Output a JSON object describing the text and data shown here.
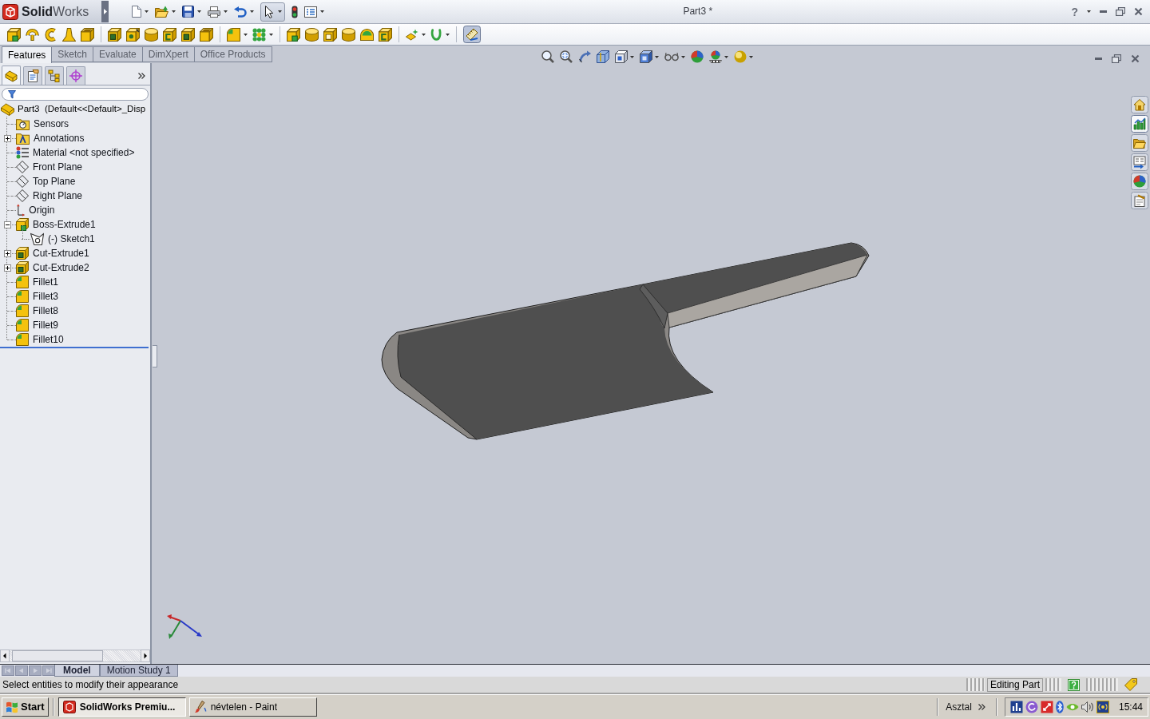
{
  "window": {
    "app_name": "**Solid**Works",
    "title": "Part3 *",
    "help": "?"
  },
  "command_tabs": [
    {
      "label": "Features",
      "selected": true
    },
    {
      "label": "Sketch",
      "selected": false
    },
    {
      "label": "Evaluate",
      "selected": false
    },
    {
      "label": "DimXpert",
      "selected": false
    },
    {
      "label": "Office Products",
      "selected": false
    }
  ],
  "panel_tabs": [
    {
      "kind": "feature-manager",
      "selected": true
    },
    {
      "kind": "property-manager",
      "selected": false
    },
    {
      "kind": "configuration-manager",
      "selected": false
    },
    {
      "kind": "dimxpert-manager",
      "selected": false
    }
  ],
  "feature_tree": {
    "root": "Part3  (Default<<Default>_Disp",
    "items": [
      {
        "kind": "sensors",
        "label": "Sensors"
      },
      {
        "kind": "annotations",
        "label": "Annotations",
        "expanded": false
      },
      {
        "kind": "material",
        "label": "Material <not specified>"
      },
      {
        "kind": "plane",
        "label": "Front Plane"
      },
      {
        "kind": "plane",
        "label": "Top Plane"
      },
      {
        "kind": "plane",
        "label": "Right Plane"
      },
      {
        "kind": "origin",
        "label": "Origin"
      },
      {
        "kind": "boss-extrude",
        "label": "Boss-Extrude1",
        "expanded": true,
        "children": [
          {
            "kind": "sketch",
            "label": "(-) Sketch1"
          }
        ]
      },
      {
        "kind": "cut-extrude",
        "label": "Cut-Extrude1",
        "expanded": false
      },
      {
        "kind": "cut-extrude",
        "label": "Cut-Extrude2",
        "expanded": false
      },
      {
        "kind": "fillet",
        "label": "Fillet1"
      },
      {
        "kind": "fillet",
        "label": "Fillet3"
      },
      {
        "kind": "fillet",
        "label": "Fillet8"
      },
      {
        "kind": "fillet",
        "label": "Fillet9"
      },
      {
        "kind": "fillet",
        "label": "Fillet10"
      }
    ]
  },
  "task_pane": [
    {
      "kind": "home",
      "selected": false
    },
    {
      "kind": "resources",
      "selected": true
    },
    {
      "kind": "folder",
      "selected": false
    },
    {
      "kind": "view-palette",
      "selected": false
    },
    {
      "kind": "appearances",
      "selected": false
    },
    {
      "kind": "properties",
      "selected": false
    }
  ],
  "view_tabs": [
    {
      "label": "Model",
      "selected": true
    },
    {
      "label": "Motion Study 1",
      "selected": false
    }
  ],
  "status_bar": {
    "message": "Select entities to modify their appearance",
    "mode": "Editing Part"
  },
  "taskbar": {
    "start": "Start",
    "tasks": [
      {
        "kind": "solidworks",
        "label": "SolidWorks Premiu...",
        "selected": true
      },
      {
        "kind": "paint",
        "label": "névtelen - Paint",
        "selected": false
      }
    ],
    "toolbar": "Asztal",
    "clock": "15:44"
  }
}
